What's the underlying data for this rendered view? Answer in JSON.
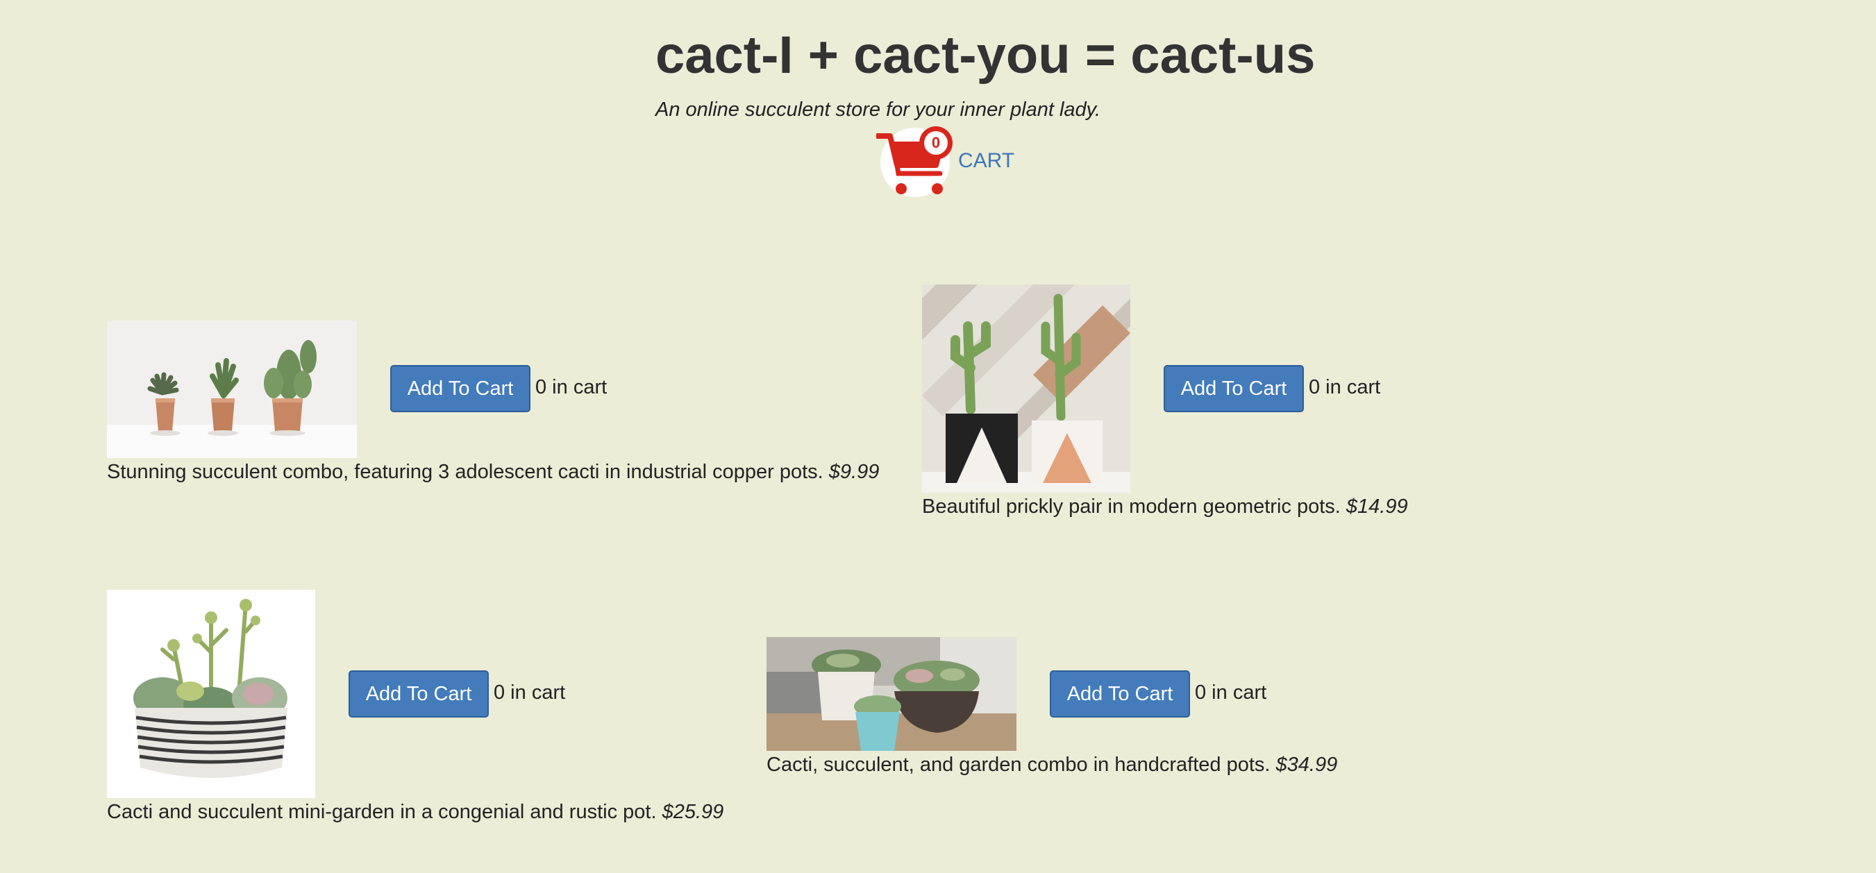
{
  "header": {
    "title": "cact-I + cact-you = cact-us",
    "tagline": "An online succulent store for your inner plant lady."
  },
  "cart": {
    "count": "0",
    "label": "CART",
    "icon": "shopping-cart-icon"
  },
  "colors": {
    "background": "#ebedd7",
    "button": "#437bbb",
    "cart_link": "#3f76b8",
    "cart_icon": "#d9261c"
  },
  "products": [
    {
      "image": "three-cacti-in-copper-pots-photo",
      "button_label": "Add To Cart",
      "in_cart": "0 in cart",
      "description": "Stunning succulent combo, featuring 3 adolescent cacti in industrial copper pots.",
      "price": "$9.99"
    },
    {
      "image": "two-cacti-in-geometric-pots-photo",
      "button_label": "Add To Cart",
      "in_cart": "0 in cart",
      "description": "Beautiful prickly pair in modern geometric pots.",
      "price": "$14.99"
    },
    {
      "image": "succulent-mini-garden-bowl-photo",
      "button_label": "Add To Cart",
      "in_cart": "0 in cart",
      "description": "Cacti and succulent mini-garden in a congenial and rustic pot.",
      "price": "$25.99"
    },
    {
      "image": "succulents-in-handcrafted-pots-photo",
      "button_label": "Add To Cart",
      "in_cart": "0 in cart",
      "description": "Cacti, succulent, and garden combo in handcrafted pots.",
      "price": "$34.99"
    }
  ]
}
